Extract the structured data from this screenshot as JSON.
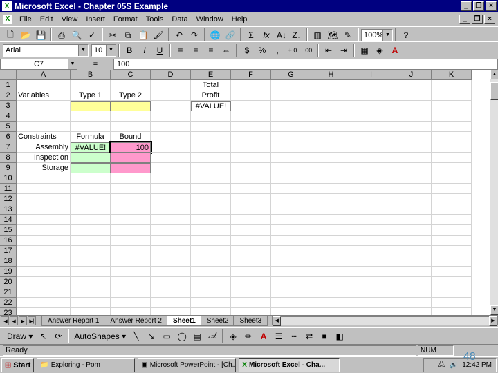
{
  "window": {
    "title": "Microsoft Excel - Chapter 05S Example",
    "app_icon": "excel-icon"
  },
  "menu": [
    "File",
    "Edit",
    "View",
    "Insert",
    "Format",
    "Tools",
    "Data",
    "Window",
    "Help"
  ],
  "toolbar": {
    "zoom": "100%"
  },
  "format_toolbar": {
    "font": "Arial",
    "size": "10"
  },
  "formula_bar": {
    "name_box": "C7",
    "equals": "=",
    "value": "100"
  },
  "columns": [
    "A",
    "B",
    "C",
    "D",
    "E",
    "F",
    "G",
    "H",
    "I",
    "J",
    "K"
  ],
  "rows": [
    "1",
    "2",
    "3",
    "4",
    "5",
    "6",
    "7",
    "8",
    "9",
    "10",
    "11",
    "12",
    "13",
    "14",
    "15",
    "16",
    "17",
    "18",
    "19",
    "20",
    "21",
    "22",
    "23"
  ],
  "cells": {
    "E1": "Total",
    "A2": "Variables",
    "B2": "Type 1",
    "C2": "Type 2",
    "E2": "Profit",
    "E3": "#VALUE!",
    "A6": "Constraints",
    "B6": "Formula",
    "C6": "Bound",
    "A7": "Assembly",
    "B7": "#VALUE!",
    "C7": "100",
    "A8": "Inspection",
    "A9": "Storage"
  },
  "colors": {
    "yellow": "#ffff99",
    "green": "#ccffcc",
    "pink": "#ff99cc",
    "title_bar": "#000080"
  },
  "sheet_tabs": [
    "Answer Report 1",
    "Answer Report 2",
    "Sheet1",
    "Sheet2",
    "Sheet3"
  ],
  "active_sheet": "Sheet1",
  "drawing_toolbar": {
    "draw": "Draw",
    "autoshapes": "AutoShapes"
  },
  "status": {
    "ready": "Ready",
    "num": "NUM"
  },
  "taskbar": {
    "start": "Start",
    "tasks": [
      "Exploring - Pom",
      "Microsoft PowerPoint - [Ch...",
      "Microsoft Excel - Cha..."
    ],
    "clock": "12:42 PM"
  },
  "slide_number": "48"
}
